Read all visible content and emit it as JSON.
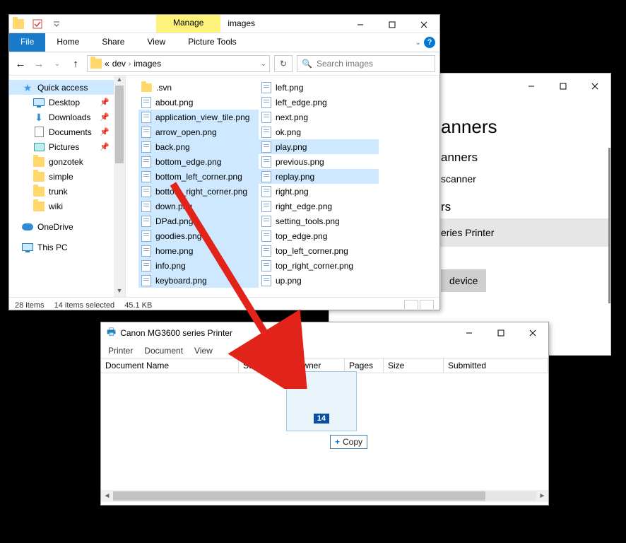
{
  "settings": {
    "h1": "anners",
    "h2": "anners",
    "row_scanner": "scanner",
    "h3": "rs",
    "sel_printer": "eries Printer",
    "btn": "device"
  },
  "explorer": {
    "manage": "Manage",
    "title": "images",
    "tabs": {
      "file": "File",
      "home": "Home",
      "share": "Share",
      "view": "View",
      "pt": "Picture Tools"
    },
    "crumbs": {
      "a": "«",
      "b": "dev",
      "c": "images"
    },
    "search_placeholder": "Search images",
    "nav": {
      "quick": "Quick access",
      "desktop": "Desktop",
      "downloads": "Downloads",
      "documents": "Documents",
      "pictures": "Pictures",
      "gonzotek": "gonzotek",
      "simple": "simple",
      "trunk": "trunk",
      "wiki": "wiki",
      "onedrive": "OneDrive",
      "thispc": "This PC"
    },
    "col1": [
      {
        "n": ".svn",
        "folder": true,
        "sel": false
      },
      {
        "n": "about.png",
        "sel": false
      },
      {
        "n": "application_view_tile.png",
        "sel": true
      },
      {
        "n": "arrow_open.png",
        "sel": true
      },
      {
        "n": "back.png",
        "sel": true
      },
      {
        "n": "bottom_edge.png",
        "sel": true
      },
      {
        "n": "bottom_left_corner.png",
        "sel": true
      },
      {
        "n": "bottom_right_corner.png",
        "sel": true
      },
      {
        "n": "down.png",
        "sel": true
      },
      {
        "n": "DPad.png",
        "sel": true
      },
      {
        "n": "goodies.png",
        "sel": true
      },
      {
        "n": "home.png",
        "sel": true
      },
      {
        "n": "info.png",
        "sel": true
      },
      {
        "n": "keyboard.png",
        "sel": true
      }
    ],
    "col2": [
      {
        "n": "left.png",
        "sel": false
      },
      {
        "n": "left_edge.png",
        "sel": false
      },
      {
        "n": "next.png",
        "sel": false
      },
      {
        "n": "ok.png",
        "sel": false
      },
      {
        "n": "play.png",
        "sel": true
      },
      {
        "n": "previous.png",
        "sel": false
      },
      {
        "n": "replay.png",
        "sel": true
      },
      {
        "n": "right.png",
        "sel": false
      },
      {
        "n": "right_edge.png",
        "sel": false
      },
      {
        "n": "setting_tools.png",
        "sel": false
      },
      {
        "n": "top_edge.png",
        "sel": false
      },
      {
        "n": "top_left_corner.png",
        "sel": false
      },
      {
        "n": "top_right_corner.png",
        "sel": false
      },
      {
        "n": "up.png",
        "sel": false
      }
    ],
    "status": {
      "items": "28 items",
      "selected": "14 items selected",
      "size": "45.1 KB"
    }
  },
  "queue": {
    "title": "Canon MG3600 series Printer",
    "menu": {
      "printer": "Printer",
      "document": "Document",
      "view": "View"
    },
    "cols": {
      "doc": "Document Name",
      "status": "Status",
      "owner": "Owner",
      "pages": "Pages",
      "size": "Size",
      "submitted": "Submitted"
    }
  },
  "drag": {
    "count": "14",
    "copy": "Copy"
  }
}
